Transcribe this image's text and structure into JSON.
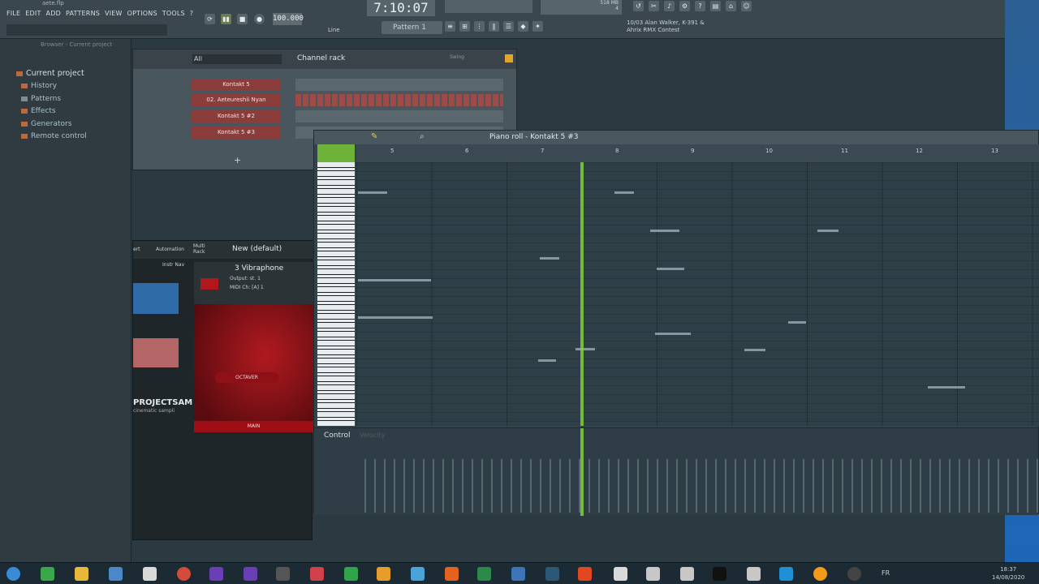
{
  "app": {
    "file_title": "aete.flp",
    "menu": [
      "FILE",
      "EDIT",
      "ADD",
      "PATTERNS",
      "VIEW",
      "OPTIONS",
      "TOOLS",
      "?"
    ],
    "time_display": "7:10:07",
    "tempo": "100.000",
    "pattern_label": "Pattern 1",
    "snap_mode": "Line",
    "news_line1": "10/03  Alan Walker, K-391 &",
    "news_line2": "Ahrix RMX Contest",
    "cpu_value": "518 MB",
    "cpu_number": "4"
  },
  "browser": {
    "header": "Browser - Current project",
    "root": "Current project",
    "items": [
      "History",
      "Patterns",
      "Effects",
      "Generators",
      "Remote control"
    ]
  },
  "channel_rack": {
    "filter": "All",
    "title": "Channel rack",
    "swing_label": "Swing",
    "channels": [
      "Kontakt 5",
      "02. Aeteureshii Nyan",
      "Kontakt 5 #2",
      "Kontakt 5 #3"
    ],
    "add_label": "+"
  },
  "piano_roll": {
    "title": "Piano roll - Kontakt 5 #3",
    "ruler": [
      "5",
      "6",
      "7",
      "8",
      "9",
      "10",
      "11",
      "12",
      "13"
    ],
    "control_label": "Control",
    "control_value": "Velocity"
  },
  "plugin": {
    "tab_left": "ert",
    "tab_automation": "Automation",
    "multi_rack": "Multi Rack",
    "preset": "New (default)",
    "instr_label": "Instr Nav",
    "instrument": "3 Vibraphone",
    "output": "Output: st. 1",
    "midi": "MIDI Ch: [A] 1",
    "library": "PROJECTSAM",
    "library_sub": "cinematic sampli",
    "button_octaver": "OCTAVER",
    "button_main": "MAIN"
  },
  "taskbar": {
    "lang": "FR",
    "time": "18:37",
    "date": "14/08/2020"
  },
  "colors": {
    "accent_green": "#7fd13b",
    "channel_red": "#8a3d3b",
    "kontakt_red": "#b01a1f"
  }
}
